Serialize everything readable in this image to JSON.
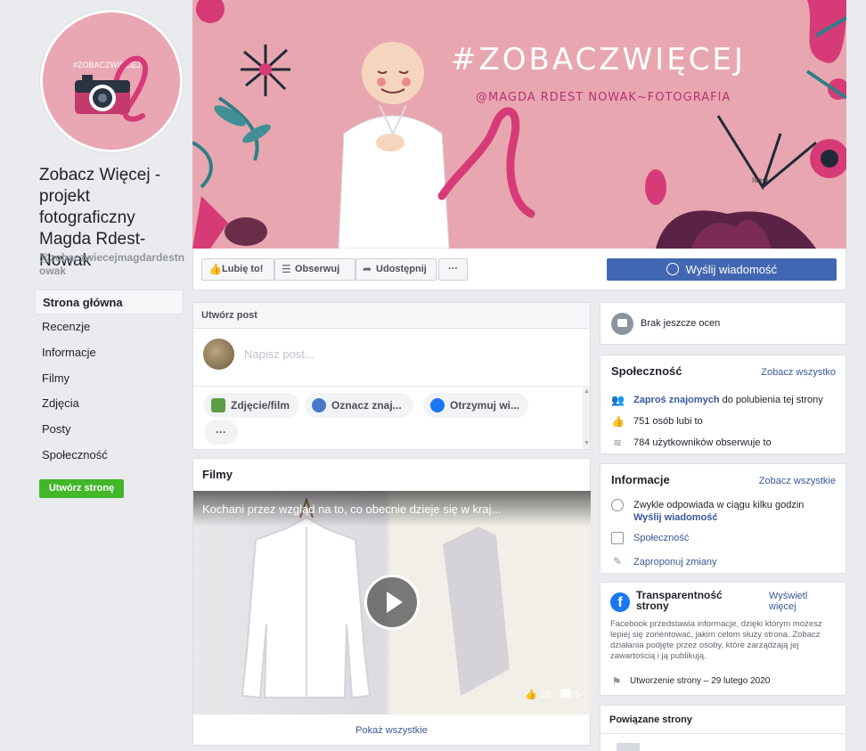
{
  "profile": {
    "name": "Zobacz Więcej - projekt fotograficzny Magda Rdest-Nowak",
    "handle": "@zobaczwiecejmagdardestnowak",
    "logo_text": "#ZOBACZWIĘCEJ"
  },
  "nav": {
    "items": [
      {
        "label": "Strona główna"
      },
      {
        "label": "Recenzje"
      },
      {
        "label": "Informacje"
      },
      {
        "label": "Filmy"
      },
      {
        "label": "Zdjęcia"
      },
      {
        "label": "Posty"
      },
      {
        "label": "Społeczność"
      }
    ],
    "create_page": "Utwórz stronę"
  },
  "cover": {
    "hashtag": "#ZOBACZWIĘCEJ",
    "credit": "@MAGDA RDEST NOWAK~FOTOGRAFIA",
    "signature": "lilew"
  },
  "actions": {
    "like": "Lubię to!",
    "follow": "Obserwuj",
    "share": "Udostępnij",
    "more": "···",
    "send_message": "Wyślij wiadomość"
  },
  "create_post": {
    "title": "Utwórz post",
    "placeholder": "Napisz post...",
    "chips": [
      {
        "label": "Zdjęcie/film"
      },
      {
        "label": "Oznacz znaj..."
      },
      {
        "label": "Otrzymuj wi..."
      }
    ],
    "more": "···"
  },
  "films": {
    "title": "Filmy",
    "video_title": "Kochani przez wzgląd na to, co obecnie dzieje się w kraj...",
    "likes": "13",
    "comments": "5",
    "show_all": "Pokaż wszystkie"
  },
  "reviews": {
    "text": "Brak jeszcze ocen"
  },
  "community": {
    "title": "Społeczność",
    "see_all": "Zobacz wszystko",
    "invite_link": "Zaproś znajomych",
    "invite_rest": " do polubienia tej strony",
    "likes": "751 osób lubi to",
    "followers": "784 użytkowników obserwuje to"
  },
  "info": {
    "title": "Informacje",
    "see_all": "Zobacz wszystkie",
    "response": "Zwykle odpowiada w ciągu kilku godzin",
    "send_message": "Wyślij wiadomość",
    "category": "Społeczność",
    "suggest": "Zaproponuj zmiany"
  },
  "transparency": {
    "title": "Transparentność strony",
    "see_more": "Wyświetl więcej",
    "body": "Facebook przedstawia informacje, dzięki którym możesz lepiej się zorientować, jakim celom służy strona. Zobacz działania podjęte przez osoby, które zarządzają jej zawartością i ją publikują.",
    "created": "Utworzenie strony – 29 lutego 2020"
  },
  "related": {
    "title": "Powiązane strony"
  },
  "colors": {
    "fb_blue": "#4267b2",
    "link": "#385898",
    "green": "#42b72a",
    "cover_pink": "#e8a7b0",
    "ribbon": "#d63b77"
  }
}
